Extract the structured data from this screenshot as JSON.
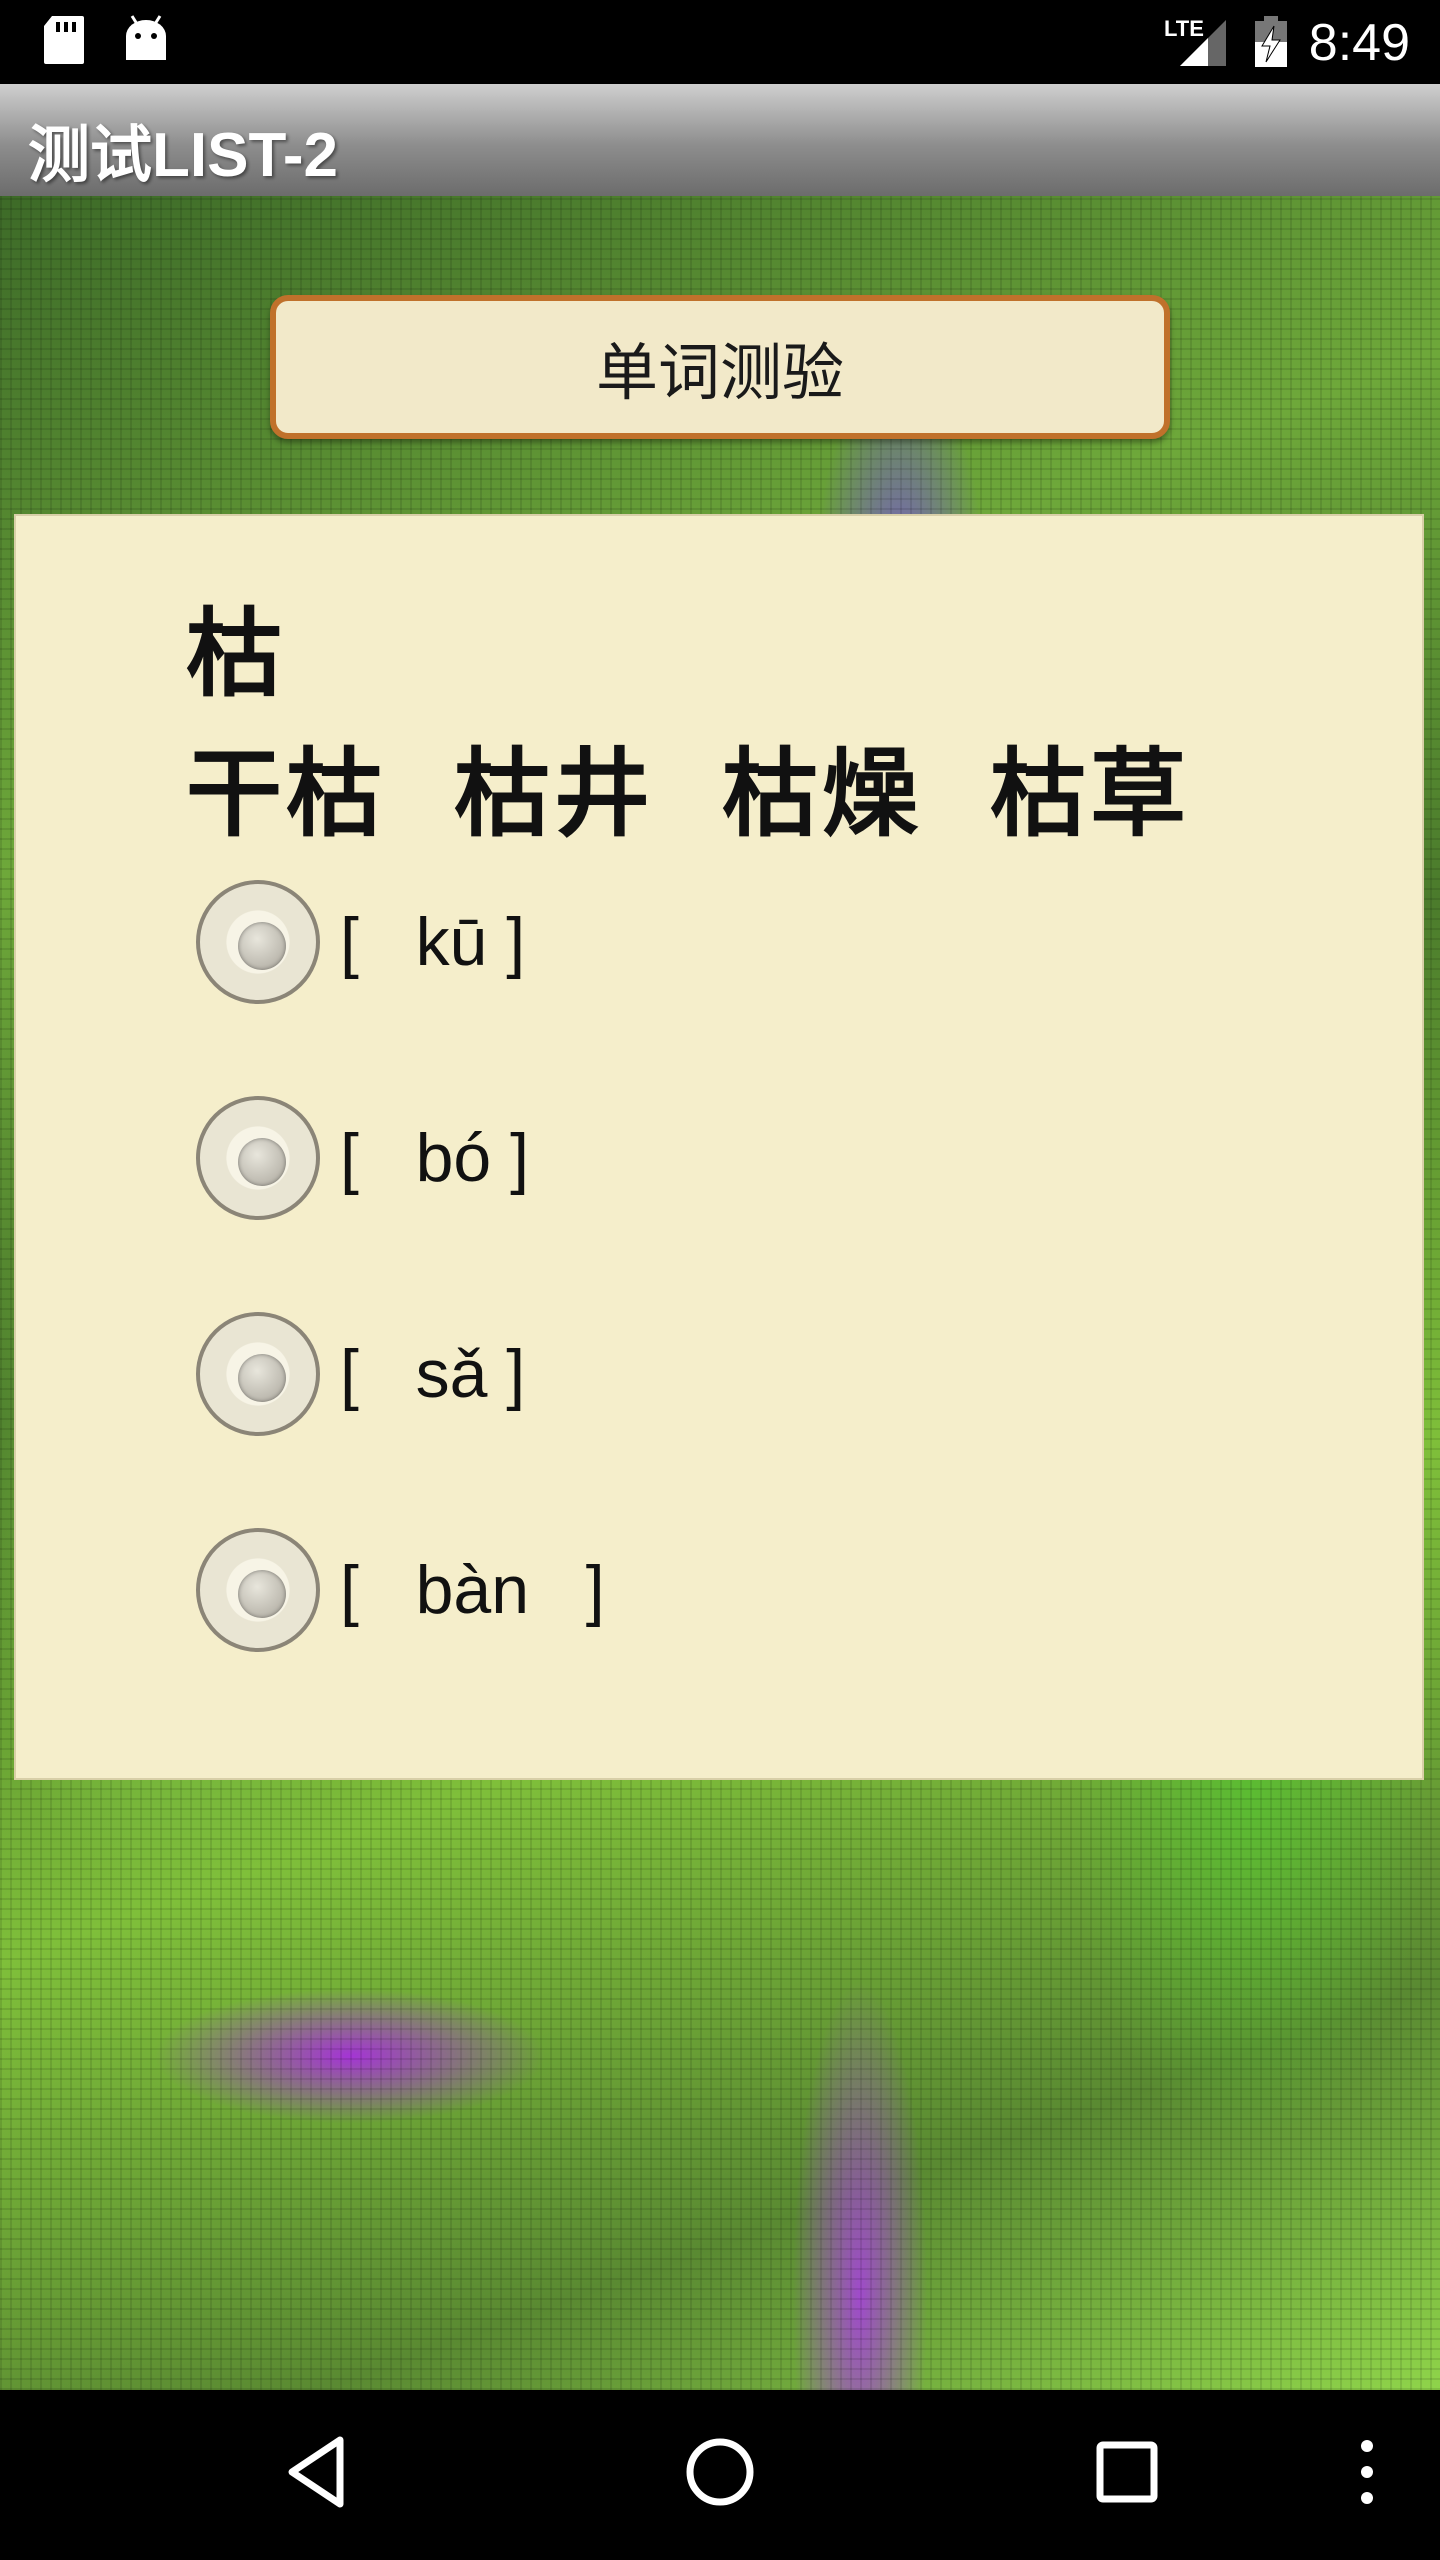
{
  "status_bar": {
    "time": "8:49",
    "network": "LTE",
    "icons": [
      "sd-card-icon",
      "android-icon",
      "signal-icon",
      "battery-charging-icon"
    ]
  },
  "action_bar": {
    "title": "测试LIST-2"
  },
  "quiz": {
    "header_button": "单词测验",
    "character": "枯",
    "words": [
      "干枯",
      "枯井",
      "枯燥",
      "枯草"
    ],
    "options": [
      {
        "label": "[   kū ]",
        "selected": false
      },
      {
        "label": "[   bó ]",
        "selected": false
      },
      {
        "label": "[   sǎ ]",
        "selected": false
      },
      {
        "label": "[   bàn   ]",
        "selected": false
      }
    ]
  },
  "nav_bar": {
    "buttons": [
      "back-icon",
      "home-icon",
      "recents-icon",
      "menu-icon"
    ]
  },
  "colors": {
    "card_bg": "#f5eecb",
    "button_border": "#c0712b",
    "button_bg": "#f2e9c9"
  }
}
